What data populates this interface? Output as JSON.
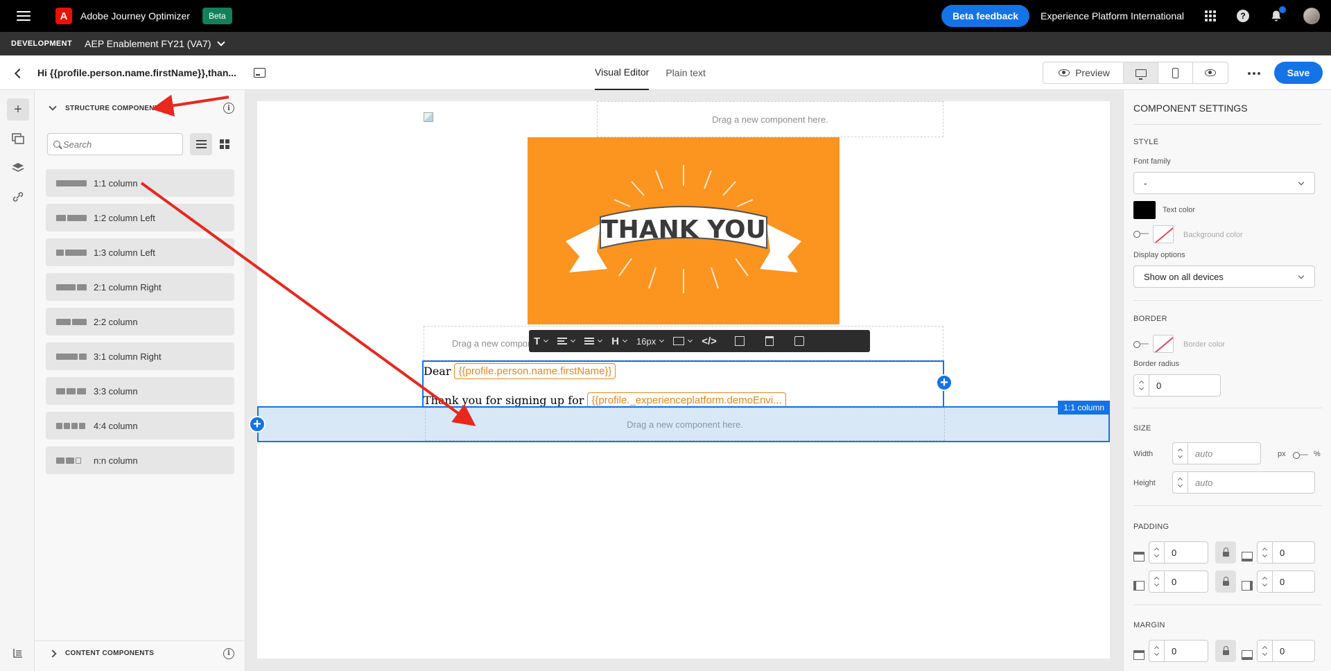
{
  "topbar": {
    "app_name": "Adobe Journey Optimizer",
    "beta_badge": "Beta",
    "beta_feedback": "Beta feedback",
    "org_name": "Experience Platform International"
  },
  "envbar": {
    "label": "DEVELOPMENT",
    "sandbox": "AEP Enablement FY21 (VA7)"
  },
  "titlebar": {
    "title": "Hi {{profile.person.name.firstName}},than...",
    "tabs": [
      "Visual Editor",
      "Plain text"
    ],
    "active_tab": "Visual Editor",
    "preview": "Preview",
    "save": "Save"
  },
  "left_panel": {
    "structure_title": "STRUCTURE COMPONENTS",
    "search_placeholder": "Search",
    "components": [
      {
        "label": "1:1 column"
      },
      {
        "label": "1:2 column Left"
      },
      {
        "label": "1:3 column Left"
      },
      {
        "label": "2:1 column Right"
      },
      {
        "label": "2:2 column"
      },
      {
        "label": "3:1 column Right"
      },
      {
        "label": "3:3 column"
      },
      {
        "label": "4:4 column"
      },
      {
        "label": "n:n column"
      }
    ],
    "content_title": "CONTENT COMPONENTS"
  },
  "canvas": {
    "dropzone_text": "Drag a new component here.",
    "dropzone_partial": "Drag a new compon",
    "hero_text": "THANK YOU",
    "line1_text": "Dear",
    "line1_token": "{{profile.person.name.firstName}}",
    "line2_text": "Thank you for signing up for",
    "line2_token": "{{profile._experienceplatform.demoEnvi...",
    "column_label": "1:1 column",
    "toolbar_font_size": "16px",
    "toolbar_heading": "H",
    "hero_bg": "#fc9420",
    "selection_color": "#1473e6"
  },
  "right_panel": {
    "title": "COMPONENT SETTINGS",
    "style": "STYLE",
    "font_family_label": "Font family",
    "font_family_value": "-",
    "text_color_label": "Text color",
    "background_color_label": "Background color",
    "display_options_label": "Display options",
    "display_options_value": "Show on all devices",
    "border": "BORDER",
    "border_color_label": "Border color",
    "border_radius_label": "Border radius",
    "border_radius_value": "0",
    "size": "SIZE",
    "width_label": "Width",
    "height_label": "Height",
    "auto": "auto",
    "px": "px",
    "percent": "%",
    "padding": "PADDING",
    "margin": "MARGIN",
    "padding_values": [
      "0",
      "0",
      "0",
      "0"
    ],
    "margin_values": [
      "0",
      "0"
    ]
  }
}
